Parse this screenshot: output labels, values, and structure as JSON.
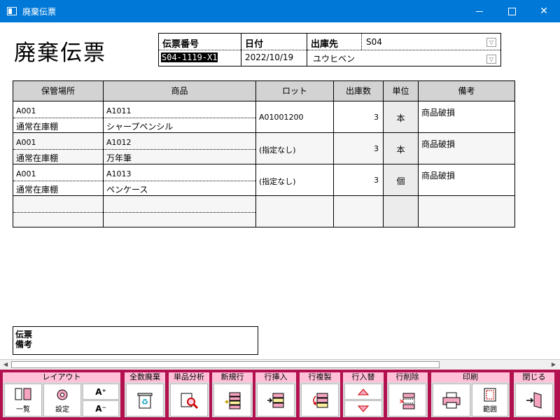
{
  "window": {
    "title": "廃棄伝票"
  },
  "page": {
    "title": "廃棄伝票"
  },
  "header": {
    "slip_no_label": "伝票番号",
    "slip_no_value": "S04-1119-X1",
    "date_label": "日付",
    "date_value": "2022/10/19",
    "dest_label": "出庫先",
    "dest_code": "S04",
    "dest_name": "ユウヒベン"
  },
  "grid": {
    "columns": [
      "保管場所",
      "商品",
      "ロット",
      "出庫数",
      "単位",
      "備考"
    ],
    "rows": [
      {
        "loc_code": "A001",
        "loc_name": "通常在庫棚",
        "item_code": "A1011",
        "item_name": "シャープペンシル",
        "lot": "A01001200",
        "qty": "3",
        "unit": "本",
        "note": "商品破損"
      },
      {
        "loc_code": "A001",
        "loc_name": "通常在庫棚",
        "item_code": "A1012",
        "item_name": "万年筆",
        "lot": "(指定なし)",
        "qty": "3",
        "unit": "本",
        "note": "商品破損"
      },
      {
        "loc_code": "A001",
        "loc_name": "通常在庫棚",
        "item_code": "A1013",
        "item_name": "ペンケース",
        "lot": "(指定なし)",
        "qty": "3",
        "unit": "個",
        "note": "商品破損"
      }
    ]
  },
  "remarks": {
    "label": "伝票\n備考"
  },
  "toolbar": {
    "layout": {
      "title": "レイアウト",
      "list_label": "一覧",
      "settings_label": "設定",
      "font_up": "A⁺",
      "font_down": "A⁻"
    },
    "dispose_all": {
      "title": "全数廃棄"
    },
    "item_analysis": {
      "title": "単品分析"
    },
    "new_row": {
      "title": "新規行"
    },
    "insert_row": {
      "title": "行挿入"
    },
    "copy_row": {
      "title": "行複製"
    },
    "swap_row": {
      "title": "行入替"
    },
    "delete_row": {
      "title": "行削除"
    },
    "print": {
      "title": "印刷",
      "range_label": "範囲"
    },
    "close": {
      "title": "閉じる"
    }
  },
  "colors": {
    "titlebar": "#0078d7",
    "toolbar": "#b2104f",
    "group_title": "#ffc0d8"
  }
}
